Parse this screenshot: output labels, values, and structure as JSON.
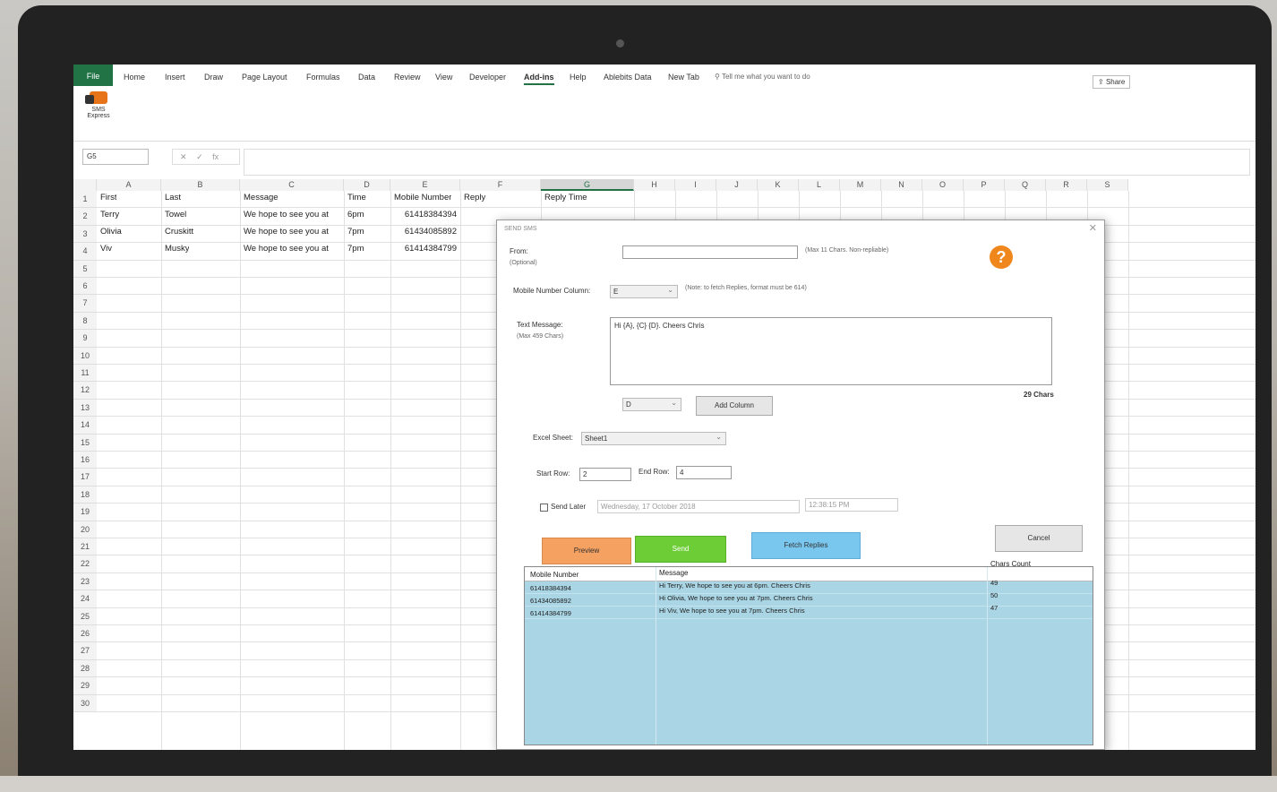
{
  "ribbon": {
    "file_tab": "File",
    "tabs": [
      "Home",
      "Insert",
      "Draw",
      "Page Layout",
      "Formulas",
      "Data",
      "Review",
      "View",
      "Developer",
      "Add-ins",
      "Help",
      "Ablebits Data",
      "New Tab"
    ],
    "tell_me": "Tell me what you want to do",
    "share": "Share",
    "sms_button_line1": "SMS",
    "sms_button_line2": "Express"
  },
  "formula_bar": {
    "name_box": "G5",
    "cancel": "✕",
    "enter": "✓",
    "fx": "fx"
  },
  "sheet": {
    "columns": [
      "A",
      "B",
      "C",
      "D",
      "E",
      "F",
      "G",
      "H",
      "I",
      "J",
      "K",
      "L",
      "M",
      "N",
      "O",
      "P",
      "Q",
      "R",
      "S"
    ],
    "rows": [
      "1",
      "2",
      "3",
      "4",
      "5",
      "6",
      "7",
      "8",
      "9",
      "10",
      "11",
      "12",
      "13",
      "14",
      "15",
      "16",
      "17",
      "18",
      "19",
      "20",
      "21",
      "22",
      "23",
      "24",
      "25",
      "26",
      "27",
      "28",
      "29",
      "30"
    ],
    "data": [
      {
        "a": "First",
        "b": "Last",
        "c": "Message",
        "d": "Time",
        "e": "Mobile Number",
        "f": "Reply",
        "g": "Reply Time"
      },
      {
        "a": "Terry",
        "b": "Towel",
        "c": "We hope to see you at",
        "d": "6pm",
        "e": "61418384394",
        "f": "",
        "g": ""
      },
      {
        "a": "Olivia",
        "b": "Cruskitt",
        "c": "We hope to see you at",
        "d": "7pm",
        "e": "61434085892",
        "f": "",
        "g": ""
      },
      {
        "a": "Viv",
        "b": "Musky",
        "c": "We hope to see you at",
        "d": "7pm",
        "e": "61414384799",
        "f": "",
        "g": ""
      }
    ]
  },
  "dialog": {
    "title": "SEND SMS",
    "close": "✕",
    "from_label": "From:",
    "from_optional": "(Optional)",
    "from_value": "",
    "from_note": "(Max 11 Chars. Non-repliable)",
    "help": "?",
    "mobile_col_label": "Mobile Number Column:",
    "mobile_col_value": "E",
    "mobile_col_note": "(Note: to fetch Replies, format must be 614)",
    "text_label": "Text Message:",
    "text_max": "(Max 459 Chars)",
    "text_value": "Hi {A}, {C} {D}. Cheers Chris",
    "chars": "29 Chars",
    "add_col_select": "D",
    "add_column": "Add Column",
    "sheet_label": "Excel Sheet:",
    "sheet_value": "Sheet1",
    "start_row_label": "Start Row:",
    "start_row": "2",
    "end_row_label": "End Row:",
    "end_row": "4",
    "send_later": "Send Later",
    "date_value": "Wednesday, 17   October   2018",
    "time_value": "12:38:15 PM",
    "preview": "Preview",
    "send": "Send",
    "fetch": "Fetch Replies",
    "cancel": "Cancel",
    "results": {
      "headers": [
        "Mobile Number",
        "Message",
        "Chars Count"
      ],
      "rows": [
        [
          "61418384394",
          "Hi Terry, We hope to see you at 6pm. Cheers Chris",
          "49"
        ],
        [
          "61434085892",
          "Hi Olivia, We hope to see you at 7pm. Cheers Chris",
          "50"
        ],
        [
          "61414384799",
          "Hi Viv, We hope to see you at 7pm. Cheers Chris",
          "47"
        ]
      ]
    }
  }
}
